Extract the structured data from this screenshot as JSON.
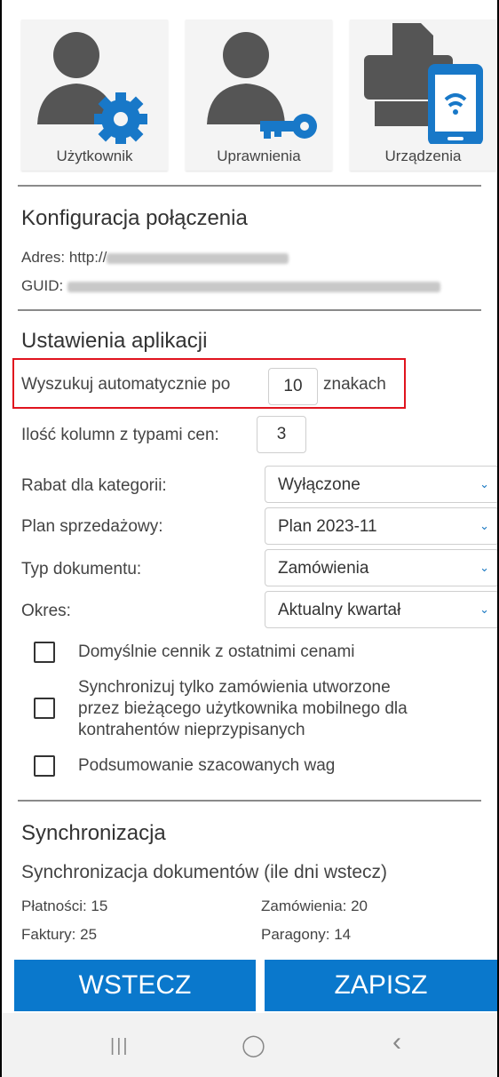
{
  "tiles": [
    {
      "label": "Użytkownik",
      "icon": "user-gear-icon"
    },
    {
      "label": "Uprawnienia",
      "icon": "user-key-icon"
    },
    {
      "label": "Urządzenia",
      "icon": "devices-icon"
    }
  ],
  "connection": {
    "title": "Konfiguracja połączenia",
    "address_label": "Adres: http://",
    "guid_label": "GUID: "
  },
  "app_settings": {
    "title": "Ustawienia aplikacji",
    "auto_search_prefix": "Wyszukuj automatycznie po",
    "auto_search_value": "10",
    "auto_search_suffix": "znakach",
    "price_columns_label": "Ilość kolumn z typami cen:",
    "price_columns_value": "3",
    "selects": [
      {
        "label": "Rabat dla kategorii:",
        "value": "Wyłączone"
      },
      {
        "label": "Plan sprzedażowy:",
        "value": "Plan 2023-11"
      },
      {
        "label": "Typ dokumentu:",
        "value": "Zamówienia"
      },
      {
        "label": "Okres:",
        "value": "Aktualny kwartał"
      }
    ],
    "checkboxes": [
      {
        "label": "Domyślnie cennik z ostatnimi cenami",
        "checked": false
      },
      {
        "label_lines": [
          "Synchronizuj tylko zamówienia utworzone",
          "przez bieżącego użytkownika mobilnego dla",
          "kontrahentów nieprzypisanych"
        ],
        "checked": false
      },
      {
        "label": "Podsumowanie szacowanych wag",
        "checked": false
      }
    ]
  },
  "sync": {
    "title": "Synchronizacja",
    "subtitle": "Synchronizacja dokumentów (ile dni wstecz)",
    "items": [
      "Płatności: 15",
      "Zamówienia: 20",
      "Faktury: 25",
      "Paragony: 14"
    ]
  },
  "buttons": {
    "back": "WSTECZ",
    "save": "ZAPISZ"
  },
  "navbar": {
    "recent": "|||",
    "home": "◯",
    "back": "‹"
  },
  "colors": {
    "accent": "#0a78cc",
    "highlight": "#e0141e"
  }
}
